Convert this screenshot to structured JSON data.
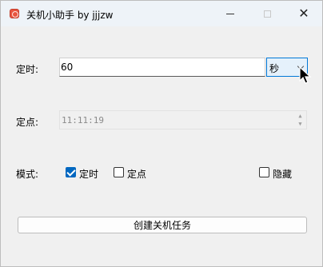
{
  "window": {
    "title": "关机小助手 by jjjzw",
    "minimize": "minimize",
    "maximize": "maximize",
    "close": "close"
  },
  "timer": {
    "label": "定时:",
    "value": "60",
    "unit": "秒"
  },
  "fixed_time": {
    "label": "定点:",
    "value": "11:11:19"
  },
  "mode": {
    "label": "模式:",
    "options": [
      {
        "label": "定时",
        "checked": true
      },
      {
        "label": "定点",
        "checked": false
      },
      {
        "label": "隐藏",
        "checked": false
      }
    ]
  },
  "actions": {
    "create_label": "创建关机任务"
  },
  "colors": {
    "accent": "#0067c0",
    "select_border": "#0078d7",
    "titlebar_bg": "#eef3f8",
    "window_bg": "#f0f0f0"
  }
}
